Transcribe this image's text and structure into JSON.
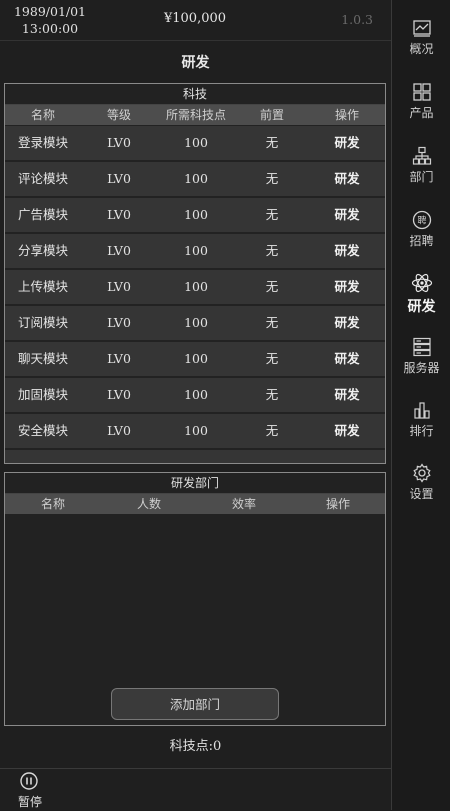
{
  "header": {
    "date": "1989/01/01",
    "time": "13:00:00",
    "money": "¥100,000",
    "version": "1.0.3"
  },
  "page_title": "研发",
  "tech_panel": {
    "title": "科技",
    "columns": [
      "名称",
      "等级",
      "所需科技点",
      "前置",
      "操作"
    ],
    "rows": [
      {
        "name": "登录模块",
        "level": "LV0",
        "cost": "100",
        "prereq": "无",
        "action": "研发"
      },
      {
        "name": "评论模块",
        "level": "LV0",
        "cost": "100",
        "prereq": "无",
        "action": "研发"
      },
      {
        "name": "广告模块",
        "level": "LV0",
        "cost": "100",
        "prereq": "无",
        "action": "研发"
      },
      {
        "name": "分享模块",
        "level": "LV0",
        "cost": "100",
        "prereq": "无",
        "action": "研发"
      },
      {
        "name": "上传模块",
        "level": "LV0",
        "cost": "100",
        "prereq": "无",
        "action": "研发"
      },
      {
        "name": "订阅模块",
        "level": "LV0",
        "cost": "100",
        "prereq": "无",
        "action": "研发"
      },
      {
        "name": "聊天模块",
        "level": "LV0",
        "cost": "100",
        "prereq": "无",
        "action": "研发"
      },
      {
        "name": "加固模块",
        "level": "LV0",
        "cost": "100",
        "prereq": "无",
        "action": "研发"
      },
      {
        "name": "安全模块",
        "level": "LV0",
        "cost": "100",
        "prereq": "无",
        "action": "研发"
      }
    ]
  },
  "dept_panel": {
    "title": "研发部门",
    "columns": [
      "名称",
      "人数",
      "效率",
      "操作"
    ],
    "add_button": "添加部门"
  },
  "tech_points": "科技点:0",
  "pause_label": "暂停",
  "sidebar": {
    "items": [
      {
        "label": "概况",
        "icon": "chart-icon"
      },
      {
        "label": "产品",
        "icon": "grid-icon"
      },
      {
        "label": "部门",
        "icon": "org-chart-icon"
      },
      {
        "label": "招聘",
        "icon": "hire-badge-icon"
      },
      {
        "label": "研发",
        "icon": "atom-icon"
      },
      {
        "label": "服务器",
        "icon": "server-icon"
      },
      {
        "label": "排行",
        "icon": "bar-chart-icon"
      },
      {
        "label": "设置",
        "icon": "gear-icon"
      }
    ]
  }
}
